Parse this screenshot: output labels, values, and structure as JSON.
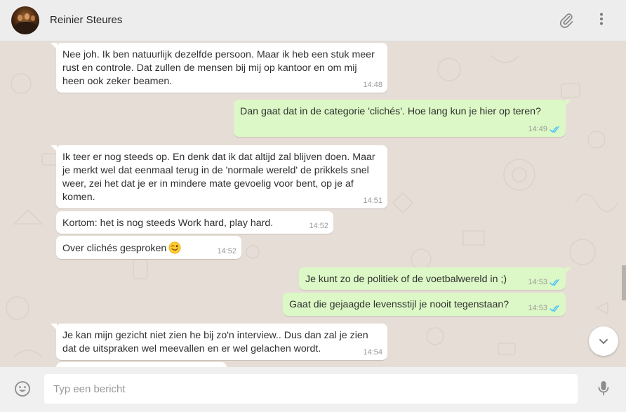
{
  "colors": {
    "incoming_bubble": "#ffffff",
    "outgoing_bubble": "#dcf8c6",
    "read_ticks": "#4fc3f7",
    "chat_background": "#e5ddd5",
    "header_background": "#ededed"
  },
  "header": {
    "contact_name": "Reinier Steures",
    "icons": [
      "avatar",
      "paperclip-icon",
      "more-vertical-icon"
    ]
  },
  "messages": [
    {
      "direction": "in",
      "text": "Nee joh. Ik ben natuurlijk dezelfde persoon. Maar ik heb een stuk meer rust en controle. Dat zullen de mensen bij mij op kantoor en om mij heen ook zeker beamen.",
      "time": "14:48"
    },
    {
      "direction": "out",
      "text": "Dan gaat dat in de categorie 'clichés'. Hoe lang kun je hier op teren?",
      "time": "14:49",
      "status": "read"
    },
    {
      "direction": "in",
      "text": "Ik teer er nog steeds op. En denk dat ik dat altijd zal blijven doen. Maar je merkt wel dat eenmaal terug in de 'normale wereld' de prikkels snel weer, zei het dat je er in mindere mate gevoelig voor bent, op je af komen.",
      "time": "14:51"
    },
    {
      "direction": "in",
      "text": "Kortom: het is nog steeds Work hard, play hard.",
      "time": "14:52"
    },
    {
      "direction": "in",
      "text": "Over clichés gesproken",
      "emoji": "winking-face-tongue-emoji",
      "time": "14:52"
    },
    {
      "direction": "out",
      "text": "Je kunt zo de politiek of de voetbalwereld in ;)",
      "time": "14:53",
      "status": "read"
    },
    {
      "direction": "out",
      "text": "Gaat die gejaagde levensstijl je nooit tegenstaan?",
      "time": "14:53",
      "status": "read"
    },
    {
      "direction": "in",
      "text": "Je kan mijn gezicht niet zien he bij zo'n interview.. Dus dan zal je zien dat de uitspraken wel meevallen en er wel gelachen wordt.",
      "time": "14:54"
    }
  ],
  "composer": {
    "placeholder": "Typ een bericht",
    "value": "",
    "icons": [
      "smiley-icon",
      "microphone-icon"
    ]
  },
  "scroll_down_icon": "chevron-down-icon"
}
